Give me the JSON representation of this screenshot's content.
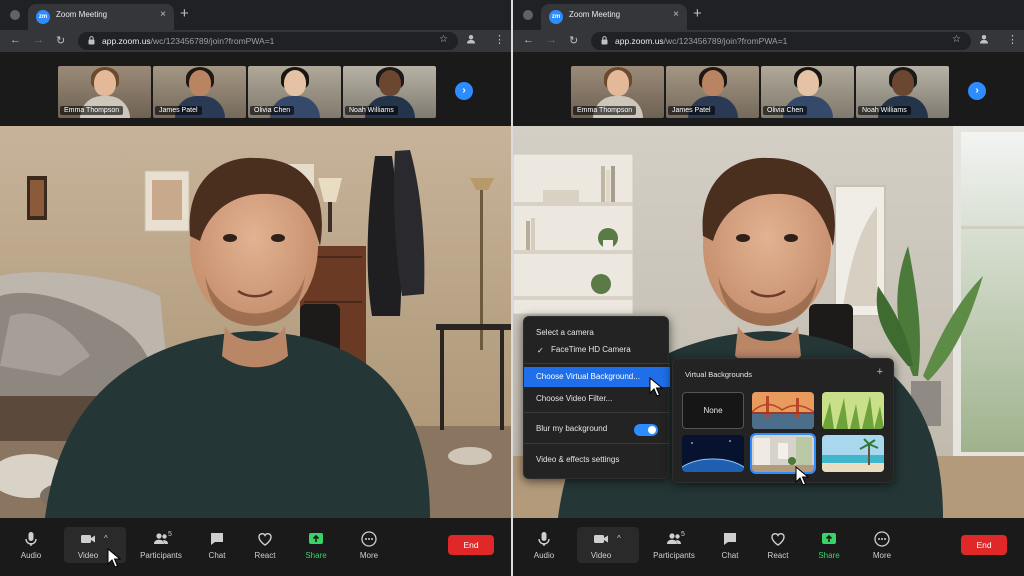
{
  "browser": {
    "tab_title": "Zoom Meeting",
    "favicon_text": "zm",
    "tab_close": "×",
    "new_tab": "+",
    "url_host": "app.zoom.us",
    "url_path": "/wc/123456789/join?fromPWA=1"
  },
  "participants": [
    {
      "name": "Emma Thompson"
    },
    {
      "name": "James Patel"
    },
    {
      "name": "Olivia Chen"
    },
    {
      "name": "Noah Williams"
    }
  ],
  "toolbar": {
    "audio": "Audio",
    "video": "Video",
    "participants": "Participants",
    "participants_count": "5",
    "chat": "Chat",
    "react": "React",
    "share": "Share",
    "more": "More",
    "end": "End"
  },
  "camera_menu": {
    "header": "Select a camera",
    "camera": "FaceTime HD Camera",
    "choose_vb": "Choose Virtual Background...",
    "choose_filter": "Choose Video Filter...",
    "blur": "Blur my background",
    "blur_on": true,
    "settings": "Video & effects settings"
  },
  "virtual_backgrounds": {
    "title": "Virtual Backgrounds",
    "add": "+",
    "none_label": "None"
  },
  "colors": {
    "accent": "#2d8cff",
    "end": "#e02828",
    "share": "#3ad267",
    "menu_active": "#1f6feb"
  }
}
